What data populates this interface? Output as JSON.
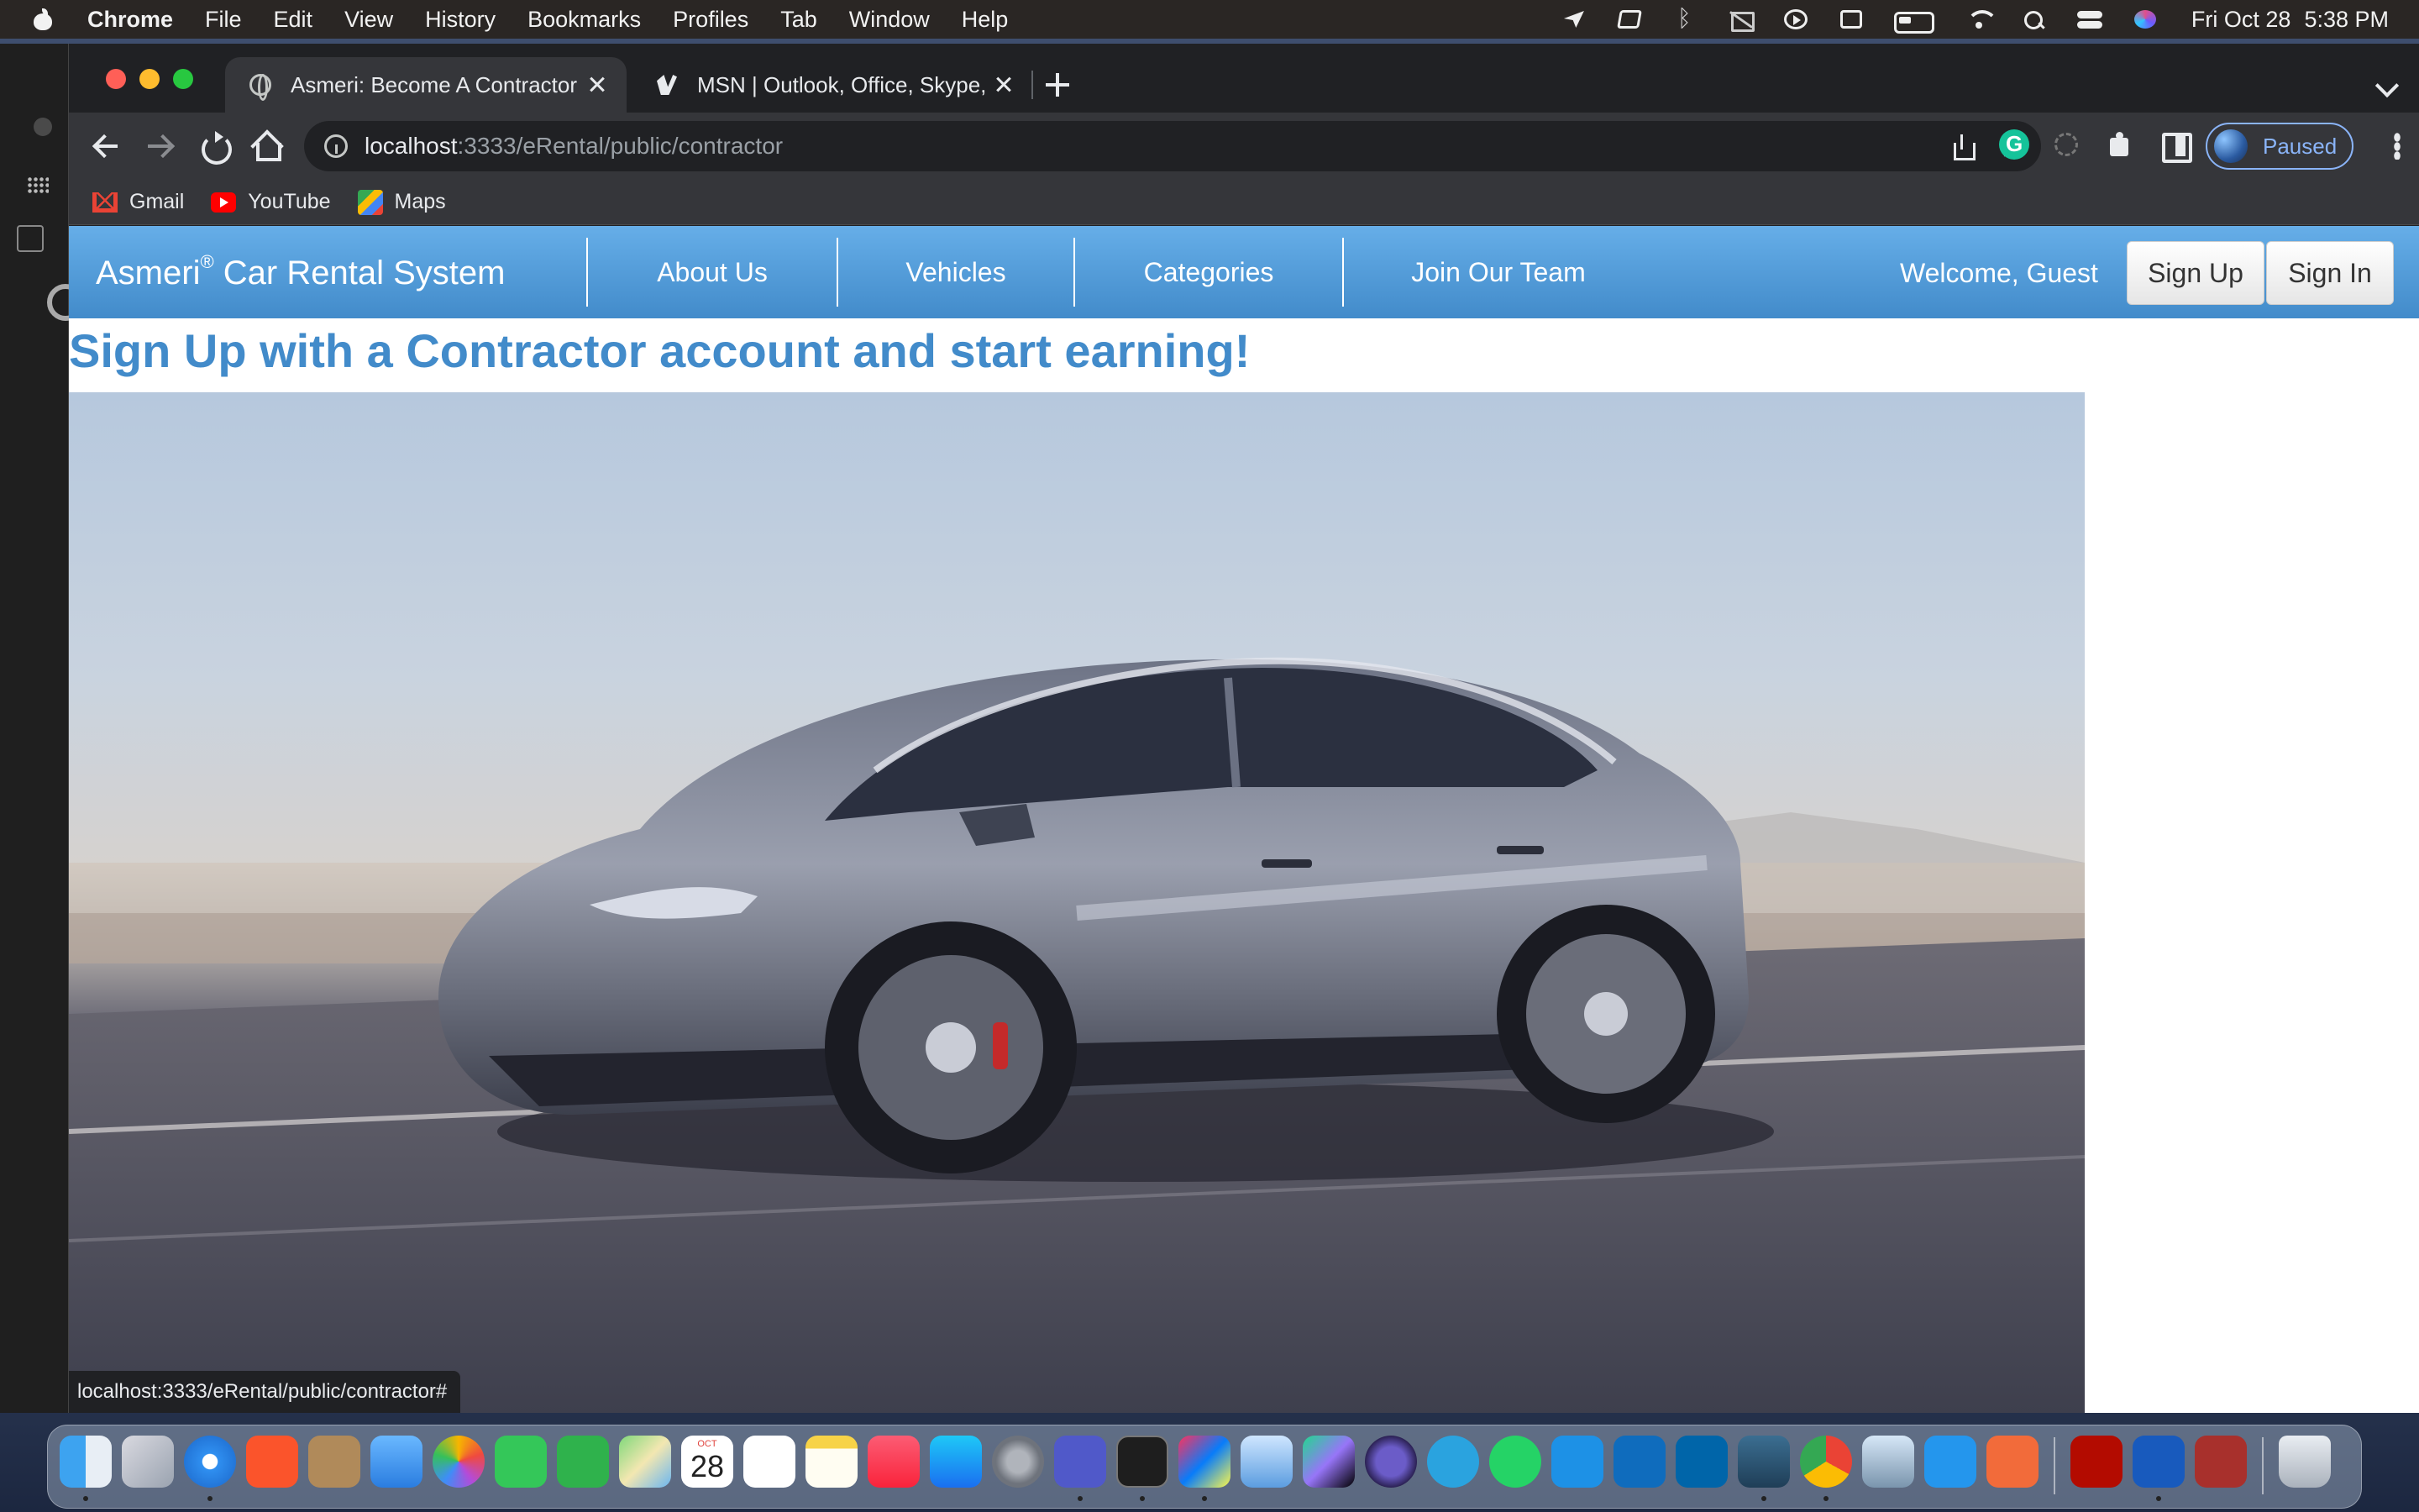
{
  "menubar": {
    "app_name": "Chrome",
    "menus": [
      "File",
      "Edit",
      "View",
      "History",
      "Bookmarks",
      "Profiles",
      "Tab",
      "Window",
      "Help"
    ],
    "status_icons": [
      "telegram-icon",
      "cube-icon",
      "bluetooth-icon",
      "mute-icon",
      "play-icon",
      "calendar-icon",
      "battery-icon",
      "wifi-icon",
      "spotlight-icon",
      "control-center-icon",
      "siri-icon"
    ],
    "date": "Fri Oct 28",
    "time": "5:38 PM"
  },
  "browser": {
    "tabs": [
      {
        "title": "Asmeri: Become A Contractor",
        "icon": "globe-icon",
        "active": true
      },
      {
        "title": "MSN | Outlook, Office, Skype, B",
        "icon": "msn-icon",
        "active": false
      }
    ],
    "address": {
      "host": "localhost",
      "path": ":3333/eRental/public/contractor"
    },
    "profile_label": "Paused",
    "bookmarks": [
      "Gmail",
      "YouTube",
      "Maps"
    ],
    "status_url": "localhost:3333/eRental/public/contractor#"
  },
  "site": {
    "brand_name": "Asmeri",
    "brand_mark": "®",
    "brand_suffix": " Car Rental System",
    "nav": [
      "About Us",
      "Vehicles",
      "Categories",
      "Join Our Team"
    ],
    "welcome": "Welcome, Guest",
    "signup_label": "Sign Up",
    "signin_label": "Sign In",
    "headline": "Sign Up with a Contractor account and start earning!",
    "hero_image": "car-photo"
  },
  "colors": {
    "accent": "#428bca",
    "nav_top": "#66aee8",
    "headline": "#428bca"
  },
  "dock": {
    "calendar_month": "OCT",
    "calendar_day": "28",
    "apps": [
      "finder",
      "launchpad",
      "safari",
      "brave",
      "contacts",
      "mail",
      "photos",
      "messages",
      "facetime",
      "maps",
      "calendar",
      "reminders",
      "notes",
      "music",
      "app-store",
      "system-preferences",
      "teams",
      "terminal",
      "intellij",
      "network-radar",
      "datagrip",
      "eclipse",
      "telegram",
      "whatsapp",
      "docker",
      "outlook",
      "vscode",
      "mysql-workbench",
      "chrome",
      "preview",
      "docker-desktop",
      "sketch",
      "acrobat",
      "word",
      "dictionary",
      "trash"
    ]
  }
}
